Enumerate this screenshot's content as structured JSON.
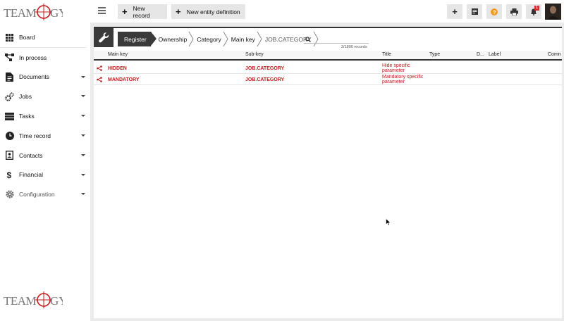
{
  "brand": {
    "logo_text": "TEAMOGY"
  },
  "sidebar": {
    "items": [
      {
        "label": "Board",
        "icon": "grid-icon",
        "has_caret": false
      },
      {
        "label": "In process",
        "icon": "process-icon",
        "has_caret": false
      },
      {
        "label": "Documents",
        "icon": "document-icon",
        "has_caret": true
      },
      {
        "label": "Jobs",
        "icon": "gears-icon",
        "has_caret": true
      },
      {
        "label": "Tasks",
        "icon": "tasks-icon",
        "has_caret": true
      },
      {
        "label": "Time record",
        "icon": "clock-icon",
        "has_caret": true
      },
      {
        "label": "Contacts",
        "icon": "contacts-icon",
        "has_caret": true
      },
      {
        "label": "Financial",
        "icon": "dollar-icon",
        "has_caret": true
      },
      {
        "label": "Configuration",
        "icon": "gear-icon",
        "has_caret": true
      }
    ]
  },
  "toolbar": {
    "new_record_label": "New record",
    "new_entity_label": "New entity definition",
    "notification_count": "1"
  },
  "breadcrumb": {
    "items": [
      "Register",
      "Ownership",
      "Category",
      "Main key",
      "JOB.CATEGORY"
    ]
  },
  "search": {
    "placeholder": "",
    "records_text": "2/1800 records"
  },
  "table": {
    "headers": [
      "Main key",
      "Sub-key",
      "Title",
      "Type",
      "D...",
      "Label",
      "Comn"
    ],
    "rows": [
      {
        "main_key": "HIDDEN",
        "sub_key": "JOB.CATEGORY",
        "title_line1": "Hide specific",
        "title_line2": "parameter"
      },
      {
        "main_key": "MANDATORY",
        "sub_key": "JOB.CATEGORY",
        "title_line1": "Mandatory specific",
        "title_line2": "parameter"
      }
    ]
  },
  "colors": {
    "accent_red": "#c21b1b",
    "dark": "#3a3a3a",
    "help_orange": "#f29a1e"
  }
}
